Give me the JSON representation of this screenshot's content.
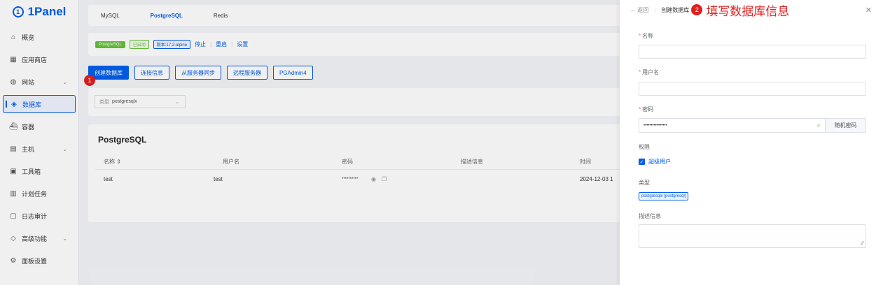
{
  "brand": {
    "name": "1Panel"
  },
  "sidebar": {
    "items": [
      {
        "label": "概览",
        "icon": "home-icon",
        "chevron": false,
        "active": false
      },
      {
        "label": "应用商店",
        "icon": "grid-icon",
        "chevron": false,
        "active": false
      },
      {
        "label": "网站",
        "icon": "globe-icon",
        "chevron": true,
        "active": false
      },
      {
        "label": "数据库",
        "icon": "layers-icon",
        "chevron": false,
        "active": true
      },
      {
        "label": "容器",
        "icon": "container-icon",
        "chevron": false,
        "active": false
      },
      {
        "label": "主机",
        "icon": "host-icon",
        "chevron": true,
        "active": false
      },
      {
        "label": "工具箱",
        "icon": "toolbox-icon",
        "chevron": false,
        "active": false
      },
      {
        "label": "计划任务",
        "icon": "calendar-icon",
        "chevron": false,
        "active": false
      },
      {
        "label": "日志审计",
        "icon": "log-icon",
        "chevron": false,
        "active": false
      },
      {
        "label": "高级功能",
        "icon": "diamond-icon",
        "chevron": true,
        "active": false
      },
      {
        "label": "面板设置",
        "icon": "gear-icon",
        "chevron": false,
        "active": false
      }
    ]
  },
  "db_tabs": [
    "MySQL",
    "PostgreSQL",
    "Redis"
  ],
  "status": {
    "app_tag": "PostgreSQL",
    "state_tag": "已启动",
    "version_tag": "版本:17.2-alpine",
    "actions": [
      "停止",
      "重启",
      "设置"
    ]
  },
  "toolbar": {
    "buttons": [
      "创建数据库",
      "连接信息",
      "从服务器同步",
      "远程服务器",
      "PGAdmin4"
    ],
    "step_marker": "1"
  },
  "filter": {
    "prefix": "类型",
    "value": "postgresqlx"
  },
  "table": {
    "title": "PostgreSQL",
    "headers": [
      "名称 ⇕",
      "用户名",
      "密码",
      "描述信息",
      "时间"
    ],
    "rows": [
      {
        "name": "test",
        "user": "test",
        "password": "**********",
        "desc": "",
        "time": "2024-12-03 1"
      }
    ]
  },
  "drawer": {
    "back": "返回",
    "title": "创建数据库",
    "step_marker": "2",
    "annotation": "填写数据库信息",
    "fields": {
      "name_label": "名称",
      "username_label": "用户名",
      "password_label": "密码",
      "password_value": "••••••••••••••••",
      "random_password_button": "随机密码",
      "permission_label": "权限",
      "superuser_label": "超级用户",
      "type_label": "类型",
      "type_value": "postgresqlx [postgresql]",
      "description_label": "描述信息"
    }
  },
  "colors": {
    "accent": "#005eeb",
    "success": "#67c23a",
    "danger": "#e02020"
  }
}
